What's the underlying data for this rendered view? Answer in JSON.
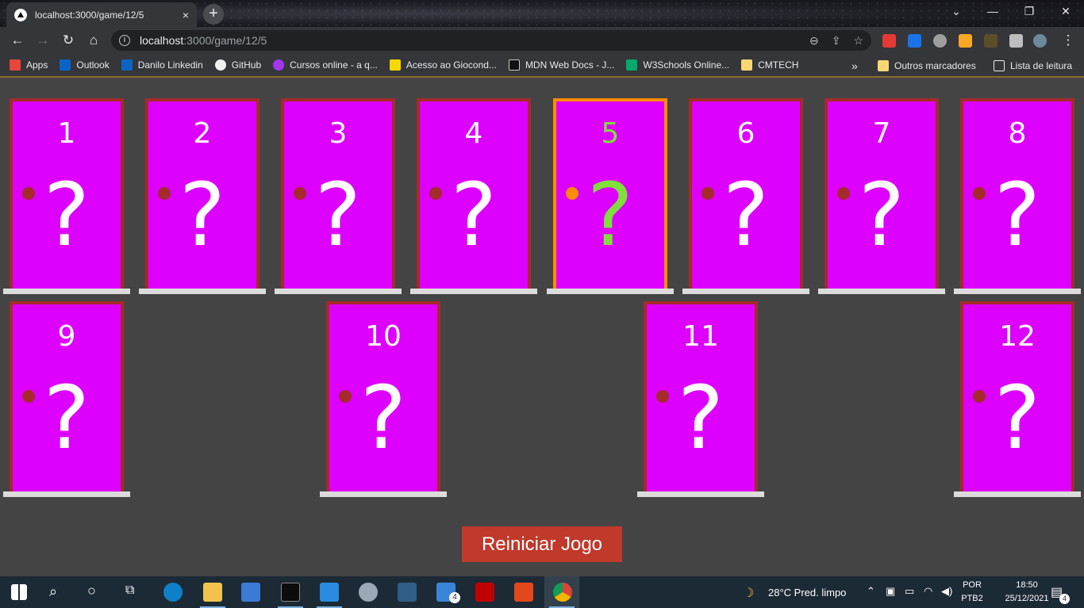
{
  "browser": {
    "tab_title": "localhost:3000/game/12/5",
    "tab_close": "×",
    "new_tab": "+",
    "window_controls": [
      "⌄",
      "—",
      "❐",
      "✕"
    ],
    "url_host": "localhost",
    "url_path": ":3000/game/12/5",
    "bookmarks": [
      {
        "label": "Apps",
        "color": "#e8453c"
      },
      {
        "label": "Outlook",
        "color": "#0a64c8"
      },
      {
        "label": "Danilo Linkedin",
        "color": "#0a66c2"
      },
      {
        "label": "GitHub",
        "color": "#f0f0f0"
      },
      {
        "label": "Cursos online - a q...",
        "color": "#a435f0"
      },
      {
        "label": "Acesso ao Giocond...",
        "color": "#f5d800"
      },
      {
        "label": "MDN Web Docs - J...",
        "color": "#111111"
      },
      {
        "label": "W3Schools Online...",
        "color": "#04aa6d"
      },
      {
        "label": "CMTECH",
        "color": "#f7d774"
      }
    ],
    "bookmarks_more": "»",
    "other_bookmarks": "Outros marcadores",
    "reading_list": "Lista de leitura"
  },
  "game": {
    "doors": [
      {
        "number": "1",
        "mark": "?",
        "selected": false
      },
      {
        "number": "2",
        "mark": "?",
        "selected": false
      },
      {
        "number": "3",
        "mark": "?",
        "selected": false
      },
      {
        "number": "4",
        "mark": "?",
        "selected": false
      },
      {
        "number": "5",
        "mark": "?",
        "selected": true
      },
      {
        "number": "6",
        "mark": "?",
        "selected": false
      },
      {
        "number": "7",
        "mark": "?",
        "selected": false
      },
      {
        "number": "8",
        "mark": "?",
        "selected": false
      },
      {
        "number": "9",
        "mark": "?",
        "selected": false
      },
      {
        "number": "10",
        "mark": "?",
        "selected": false
      },
      {
        "number": "11",
        "mark": "?",
        "selected": false
      },
      {
        "number": "12",
        "mark": "?",
        "selected": false
      }
    ],
    "colors": {
      "door": "#dd00ff",
      "frame": "#a52a2a",
      "selected_frame": "#ff8c00",
      "selected_text": "#7fe03a"
    },
    "restart_label": "Reiniciar Jogo"
  },
  "taskbar": {
    "weather": "28°C  Pred. limpo",
    "language_top": "POR",
    "language_bottom": "PTB2",
    "time": "18:50",
    "date": "25/12/2021",
    "mail_badge": "4",
    "notification_badge": "4"
  }
}
